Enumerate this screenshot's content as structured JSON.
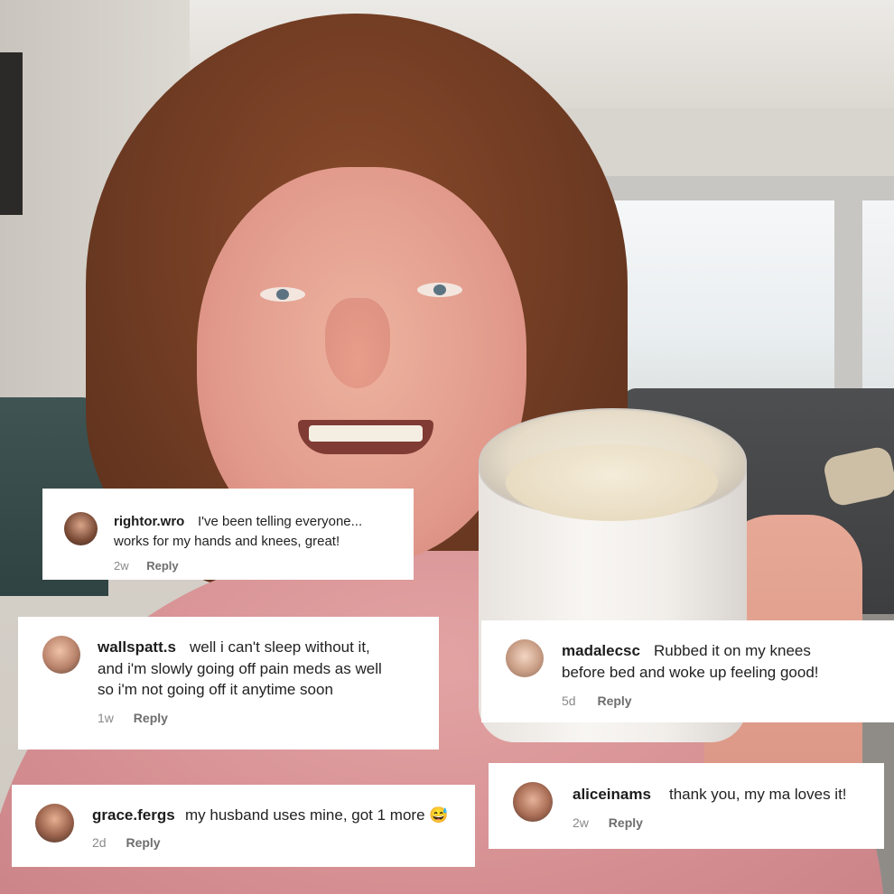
{
  "comments": [
    {
      "username": "rightor.wro",
      "lines": [
        "I've been telling everyone...",
        "works for my hands and knees, great!"
      ],
      "time": "2w",
      "reply_label": "Reply"
    },
    {
      "username": "wallspatt.s",
      "lines": [
        "well i can't sleep without it,",
        "and i'm slowly going off pain meds as well",
        "so i'm not going off it anytime soon"
      ],
      "time": "1w",
      "reply_label": "Reply"
    },
    {
      "username": "madalecsc",
      "lines": [
        "Rubbed it on my knees",
        "before bed and woke up feeling good!"
      ],
      "time": "5d",
      "reply_label": "Reply"
    },
    {
      "username": "grace.fergs",
      "lines": [
        "my husband uses mine, got 1 more 😅"
      ],
      "time": "2d",
      "reply_label": "Reply"
    },
    {
      "username": "aliceinams",
      "lines": [
        "thank you, my ma loves it!"
      ],
      "time": "2w",
      "reply_label": "Reply"
    }
  ]
}
